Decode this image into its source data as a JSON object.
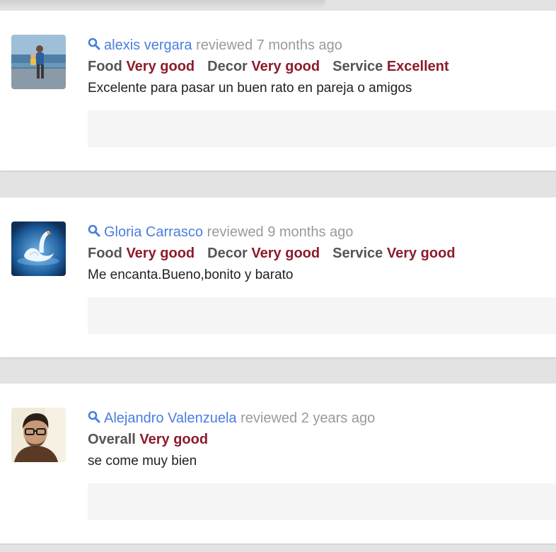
{
  "reviews": [
    {
      "reviewer": "alexis vergara",
      "reviewed_text": "reviewed 7 months ago",
      "ratings": [
        {
          "label": "Food",
          "value": "Very good"
        },
        {
          "label": "Decor",
          "value": "Very good"
        },
        {
          "label": "Service",
          "value": "Excellent"
        }
      ],
      "text": "Excelente para pasar un buen rato en pareja o amigos"
    },
    {
      "reviewer": "Gloria Carrasco",
      "reviewed_text": "reviewed 9 months ago",
      "ratings": [
        {
          "label": "Food",
          "value": "Very good"
        },
        {
          "label": "Decor",
          "value": "Very good"
        },
        {
          "label": "Service",
          "value": "Very good"
        }
      ],
      "text": "Me encanta.Bueno,bonito y barato"
    },
    {
      "reviewer": "Alejandro Valenzuela",
      "reviewed_text": "reviewed 2 years ago",
      "ratings": [
        {
          "label": "Overall",
          "value": "Very good"
        }
      ],
      "text": "se come muy bien"
    }
  ],
  "colors": {
    "reviewer_link": "#4a7de0",
    "reviewed_meta": "#9a9a9a",
    "rating_label": "#555555",
    "rating_value": "#8b1c2c",
    "page_background": "#e3e3e3",
    "card_background": "#ffffff"
  },
  "icons": {
    "reviewer_prefix": "search-icon"
  }
}
